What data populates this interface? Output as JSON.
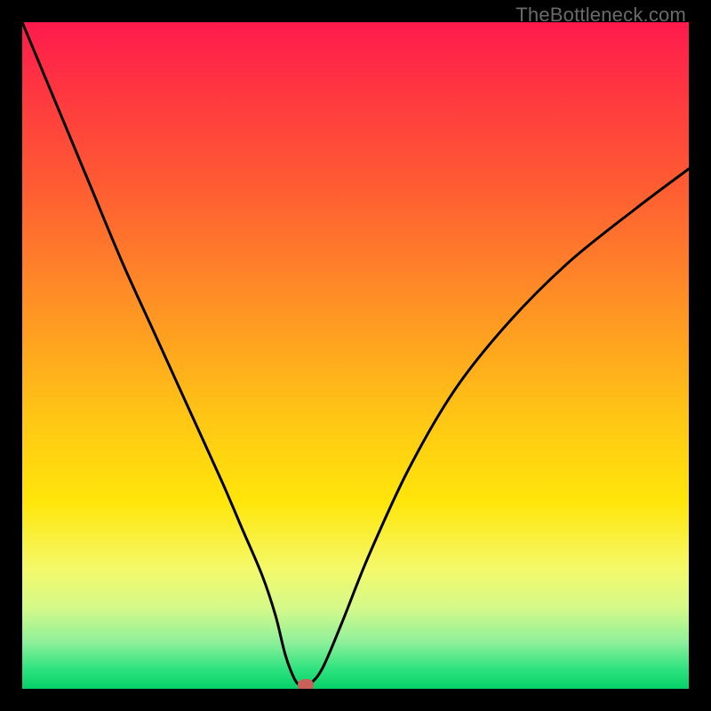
{
  "watermark": "TheBottleneck.com",
  "chart_data": {
    "type": "line",
    "title": "",
    "xlabel": "",
    "ylabel": "",
    "xlim": [
      0,
      100
    ],
    "ylim": [
      0,
      100
    ],
    "grid": false,
    "legend": false,
    "series": [
      {
        "name": "curve",
        "x": [
          0,
          5,
          10,
          15,
          20,
          25,
          30,
          33,
          36,
          38,
          39.5,
          41,
          42,
          43,
          45,
          48,
          52,
          58,
          65,
          73,
          82,
          92,
          100
        ],
        "y": [
          100,
          88,
          76,
          64,
          53,
          42,
          31,
          24,
          17,
          11,
          5,
          1.2,
          0.6,
          0.6,
          3,
          10,
          20,
          33,
          45,
          55,
          64,
          72,
          78
        ]
      }
    ],
    "marker": {
      "x": 42.5,
      "y": 0.6,
      "color": "#c9605a"
    },
    "gradient_stops": [
      {
        "pos": 0,
        "color": "#ff1a4d"
      },
      {
        "pos": 12,
        "color": "#ff3b3f"
      },
      {
        "pos": 24,
        "color": "#ff5a33"
      },
      {
        "pos": 36,
        "color": "#ff7e2a"
      },
      {
        "pos": 48,
        "color": "#ffa31f"
      },
      {
        "pos": 60,
        "color": "#ffc814"
      },
      {
        "pos": 72,
        "color": "#ffe60a"
      },
      {
        "pos": 82,
        "color": "#f4f96a"
      },
      {
        "pos": 88,
        "color": "#d4f98a"
      },
      {
        "pos": 93,
        "color": "#8ef09a"
      },
      {
        "pos": 97,
        "color": "#2fe37f"
      },
      {
        "pos": 100,
        "color": "#06d169"
      }
    ]
  }
}
